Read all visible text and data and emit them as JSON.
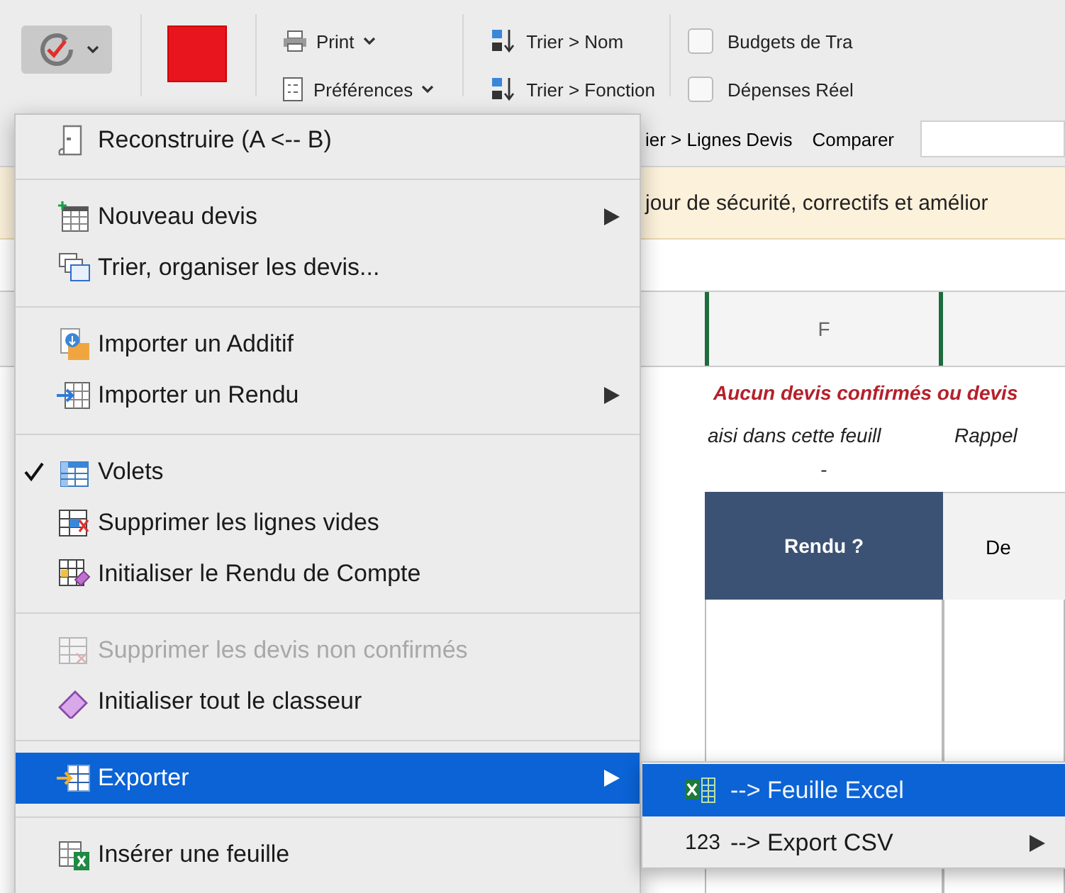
{
  "ribbon": {
    "print_menu": "Print",
    "preferences_menu": "Préférences",
    "sort_buttons": [
      "Trier > Nom",
      "Trier > Fonction"
    ],
    "checkboxes": [
      {
        "label": "Budgets de Tra",
        "checked": false
      },
      {
        "label": "Dépenses Réel",
        "checked": false
      }
    ],
    "lower_row": {
      "sort_button": "ier > Lignes Devis",
      "compare_button": "Comparer"
    }
  },
  "banner": "jour de sécurité, correctifs et amélior",
  "sheet": {
    "column_headers": [
      "F"
    ],
    "warning": "Aucun devis confirmés ou devis",
    "notes": [
      "aisi dans cette feuill",
      "Rappel"
    ],
    "signs": [
      "-"
    ],
    "table_headers": [
      "Rendu ?",
      "De"
    ]
  },
  "menu": {
    "groups": [
      {
        "items": [
          {
            "label": "Reconstruire (A <-- B)",
            "submenu": false,
            "checked": false,
            "disabled": false,
            "selected": false
          }
        ]
      },
      {
        "items": [
          {
            "label": "Nouveau devis",
            "submenu": true,
            "checked": false,
            "disabled": false,
            "selected": false
          },
          {
            "label": "Trier, organiser les devis...",
            "submenu": false,
            "checked": false,
            "disabled": false,
            "selected": false
          }
        ]
      },
      {
        "items": [
          {
            "label": "Importer un Additif",
            "submenu": false,
            "checked": false,
            "disabled": false,
            "selected": false
          },
          {
            "label": "Importer un Rendu",
            "submenu": true,
            "checked": false,
            "disabled": false,
            "selected": false
          }
        ]
      },
      {
        "items": [
          {
            "label": "Volets",
            "submenu": false,
            "checked": true,
            "disabled": false,
            "selected": false
          },
          {
            "label": "Supprimer les lignes vides",
            "submenu": false,
            "checked": false,
            "disabled": false,
            "selected": false
          },
          {
            "label": "Initialiser le Rendu de Compte",
            "submenu": false,
            "checked": false,
            "disabled": false,
            "selected": false
          }
        ]
      },
      {
        "items": [
          {
            "label": "Supprimer les devis non confirmés",
            "submenu": false,
            "checked": false,
            "disabled": true,
            "selected": false
          },
          {
            "label": "Initialiser tout le classeur",
            "submenu": false,
            "checked": false,
            "disabled": false,
            "selected": false
          }
        ]
      },
      {
        "items": [
          {
            "label": "Exporter",
            "submenu": true,
            "checked": false,
            "disabled": false,
            "selected": true
          }
        ]
      },
      {
        "items": [
          {
            "label": "Insérer une feuille",
            "submenu": false,
            "checked": false,
            "disabled": false,
            "selected": false
          }
        ]
      }
    ]
  },
  "submenu": {
    "items": [
      {
        "label": "--> Feuille Excel",
        "submenu": false,
        "selected": true
      },
      {
        "label": "--> Export CSV",
        "icon_label": "123",
        "submenu": true,
        "selected": false
      }
    ]
  }
}
